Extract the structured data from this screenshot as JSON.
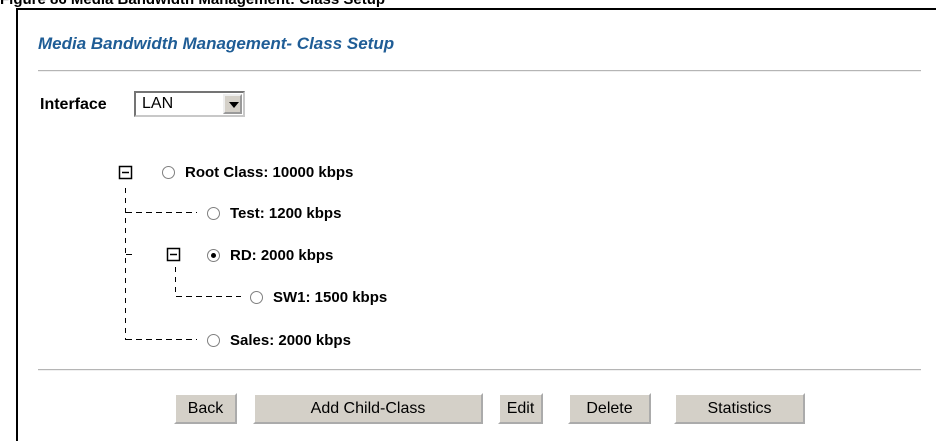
{
  "page": {
    "caption": "Figure 86   Media Bandwidth Management: Class Setup",
    "title": "Media Bandwidth Management- Class Setup"
  },
  "interface": {
    "label": "Interface",
    "selected": "LAN"
  },
  "tree": {
    "root": {
      "label": "Root Class: 10000 kbps",
      "checked": false,
      "expanded": true
    },
    "test": {
      "label": "Test: 1200 kbps",
      "checked": false
    },
    "rd": {
      "label": "RD: 2000 kbps",
      "checked": true,
      "expanded": true
    },
    "sw1": {
      "label": "SW1: 1500 kbps",
      "checked": false
    },
    "sales": {
      "label": "Sales: 2000 kbps",
      "checked": false
    }
  },
  "buttons": {
    "back": "Back",
    "add_child": "Add Child-Class",
    "edit": "Edit",
    "delete": "Delete",
    "statistics": "Statistics"
  }
}
